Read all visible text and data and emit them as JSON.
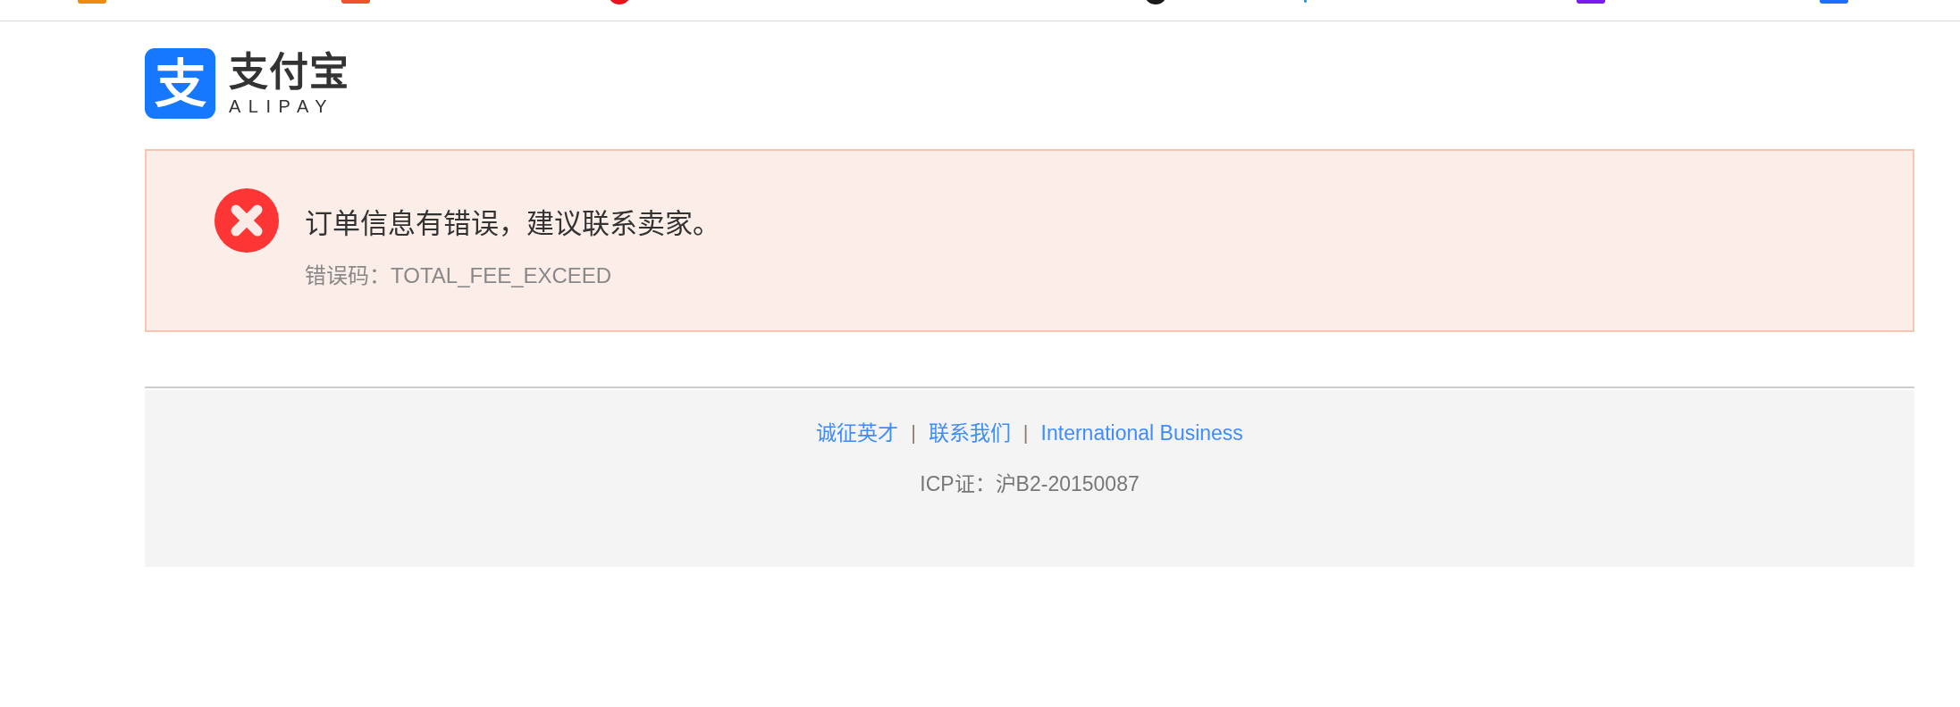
{
  "bookmarks_bar": {
    "items": [
      {
        "kind": "tile",
        "color": "#ef8a10"
      },
      {
        "kind": "tile",
        "color": "#f0522e"
      },
      {
        "kind": "circle",
        "color": "#e8141e"
      },
      {
        "kind": "circle",
        "color": "#1a1a1a"
      },
      {
        "kind": "glyph",
        "color": "#1aa0f0"
      },
      {
        "kind": "tile",
        "color": "#7a1cf0"
      },
      {
        "kind": "tile",
        "color": "#1e6fff"
      }
    ]
  },
  "logo": {
    "mark": "支",
    "name": "支付宝",
    "latin": "ALIPAY"
  },
  "error": {
    "message": "订单信息有错误，建议联系卖家。",
    "code": "错误码：TOTAL_FEE_EXCEED"
  },
  "footer": {
    "items": [
      {
        "kind": "link",
        "text": "诚征英才"
      },
      {
        "kind": "separator",
        "text": "|"
      },
      {
        "kind": "link",
        "text": "联系我们"
      },
      {
        "kind": "separator",
        "text": "|"
      },
      {
        "kind": "link",
        "text": "International Business"
      }
    ],
    "icp": "ICP证：沪B2-20150087"
  }
}
